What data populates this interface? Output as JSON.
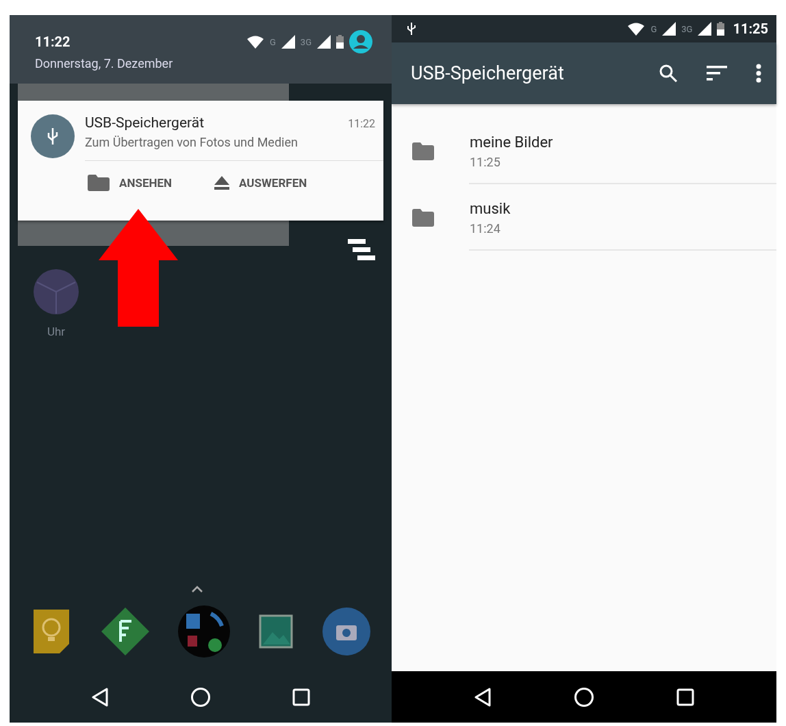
{
  "left_screen": {
    "status": {
      "time": "11:22",
      "date": "Donnerstag, 7. Dezember",
      "network_labels": [
        "G",
        "3G"
      ]
    },
    "notification": {
      "title": "USB-Speichergerät",
      "text": "Zum Übertragen von Fotos und Medien",
      "time": "11:22",
      "actions": [
        {
          "kind": "folder",
          "label": "ANSEHEN"
        },
        {
          "kind": "eject",
          "label": "AUSWERFEN"
        }
      ]
    },
    "home": {
      "app_label": "Uhr"
    }
  },
  "right_screen": {
    "status": {
      "network_labels": [
        "G",
        "3G"
      ],
      "time": "11:25"
    },
    "app_bar": {
      "title": "USB-Speichergerät"
    },
    "files": [
      {
        "name": "meine Bilder",
        "time": "11:25"
      },
      {
        "name": "musik",
        "time": "11:24"
      }
    ]
  }
}
